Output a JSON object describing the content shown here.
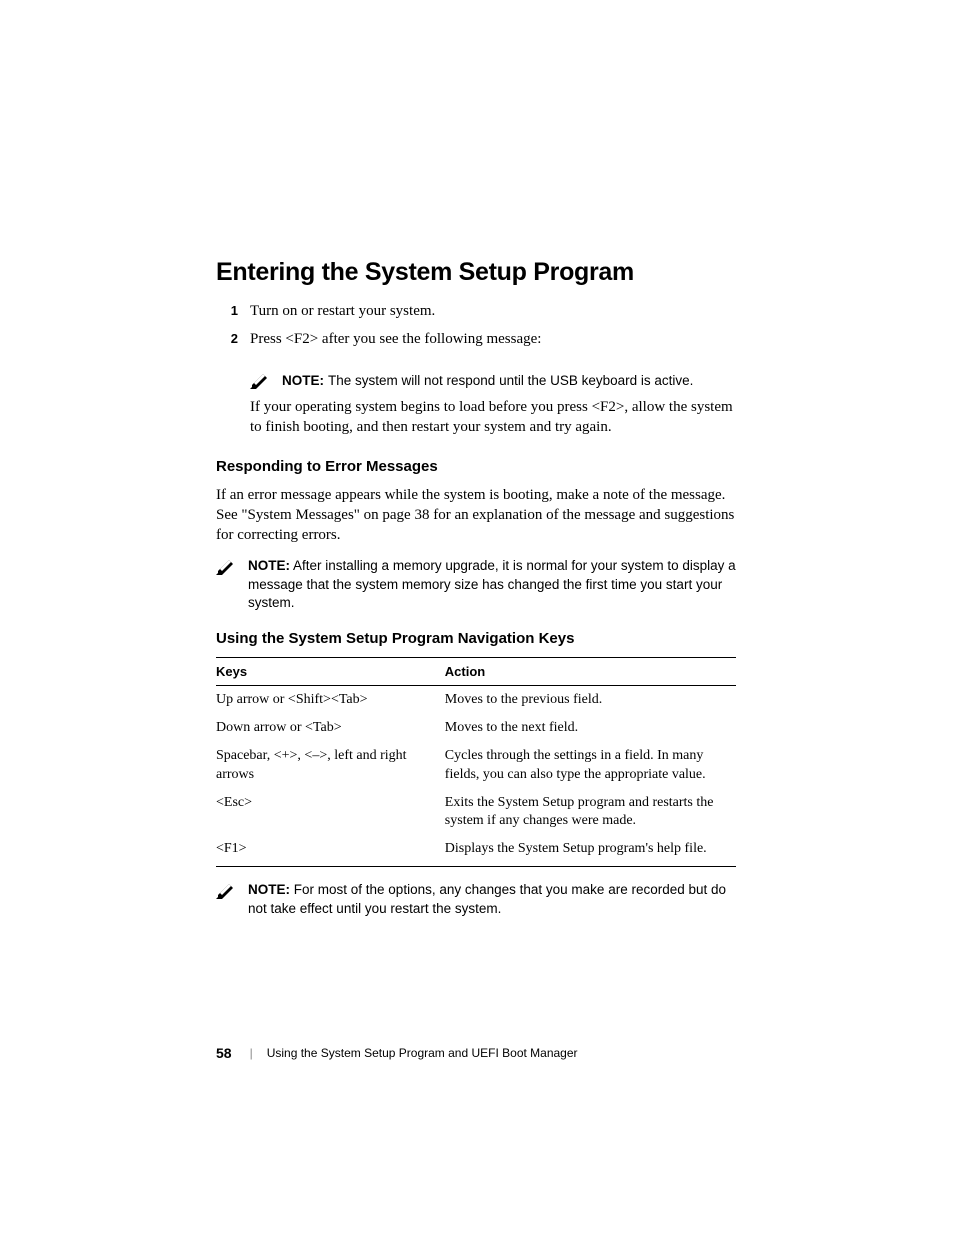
{
  "heading": "Entering the System Setup Program",
  "steps": [
    {
      "num": "1",
      "text": "Turn on or restart your system."
    },
    {
      "num": "2",
      "text": "Press <F2> after you see the following message:"
    }
  ],
  "note1": {
    "label": "NOTE:",
    "text": "The system will not respond until the USB keyboard is active."
  },
  "para1": "If your operating system begins to load before you press <F2>, allow the system to finish booting, and then restart your system and try again.",
  "h3a": "Responding to Error Messages",
  "para2": "If an error message appears while the system is booting, make a note of the message. See \"System Messages\" on page 38 for an explanation of the message and suggestions for correcting errors.",
  "note2": {
    "label": "NOTE:",
    "text": "After installing a memory upgrade, it is normal for your system to display a message that the system memory size has changed the first time you start your system."
  },
  "h3b": "Using the System Setup Program Navigation Keys",
  "table": {
    "headers": [
      "Keys",
      "Action"
    ],
    "rows": [
      {
        "k": "Up arrow or <Shift><Tab>",
        "a": "Moves to the previous field."
      },
      {
        "k": "Down arrow or <Tab>",
        "a": "Moves to the next field."
      },
      {
        "k": "Spacebar, <+>, <–>, left and right arrows",
        "a": "Cycles through the settings in a field. In many fields, you can also type the appropriate value."
      },
      {
        "k": "<Esc>",
        "a": "Exits the System Setup program and restarts the system if any changes were made."
      },
      {
        "k": "<F1>",
        "a": "Displays the System Setup program's help file."
      }
    ]
  },
  "note3": {
    "label": "NOTE:",
    "text": "For most of the options, any changes that you make are recorded but do not take effect until you restart the system."
  },
  "footer": {
    "page": "58",
    "chapter": "Using the System Setup Program and UEFI Boot Manager"
  }
}
